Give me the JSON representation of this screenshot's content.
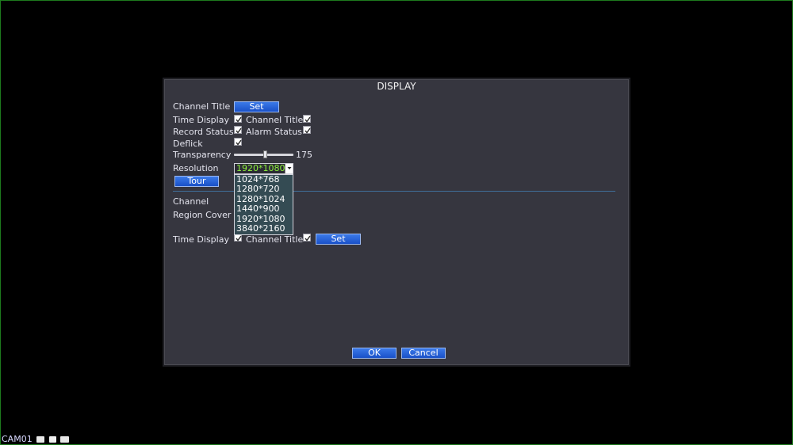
{
  "dialog": {
    "title": "DISPLAY",
    "channel_title_label": "Channel Title",
    "set_label": "Set",
    "time_display_label": "Time Display",
    "channel_title_cb_label": "Channel Title",
    "record_status_label": "Record Status",
    "alarm_status_label": "Alarm Status",
    "deflick_label": "Deflick",
    "transparency_label": "Transparency",
    "transparency_value": "175",
    "transparency_fraction": 0.53,
    "resolution_label": "Resolution",
    "resolution_selected": "1920*1080",
    "resolution_options": [
      "1024*768",
      "1280*720",
      "1280*1024",
      "1440*900",
      "1920*1080",
      "3840*2160"
    ],
    "tour_label": "Tour",
    "channel_label": "Channel",
    "region_cover_label": "Region Cover",
    "time_display_label_2": "Time Display",
    "channel_title_label_2": "Channel Title",
    "set_label_2": "Set",
    "ok_label": "OK",
    "cancel_label": "Cancel",
    "checked": {
      "time_display": true,
      "channel_title": true,
      "record_status": true,
      "alarm_status": true,
      "deflick": true,
      "time_display_2": true,
      "channel_title_2": true
    }
  },
  "status_bar": {
    "camera": "CAM01"
  },
  "colors": {
    "accent": "#2a62d8",
    "selected_text": "#8cf03c",
    "dropdown_bg": "#344b53"
  }
}
